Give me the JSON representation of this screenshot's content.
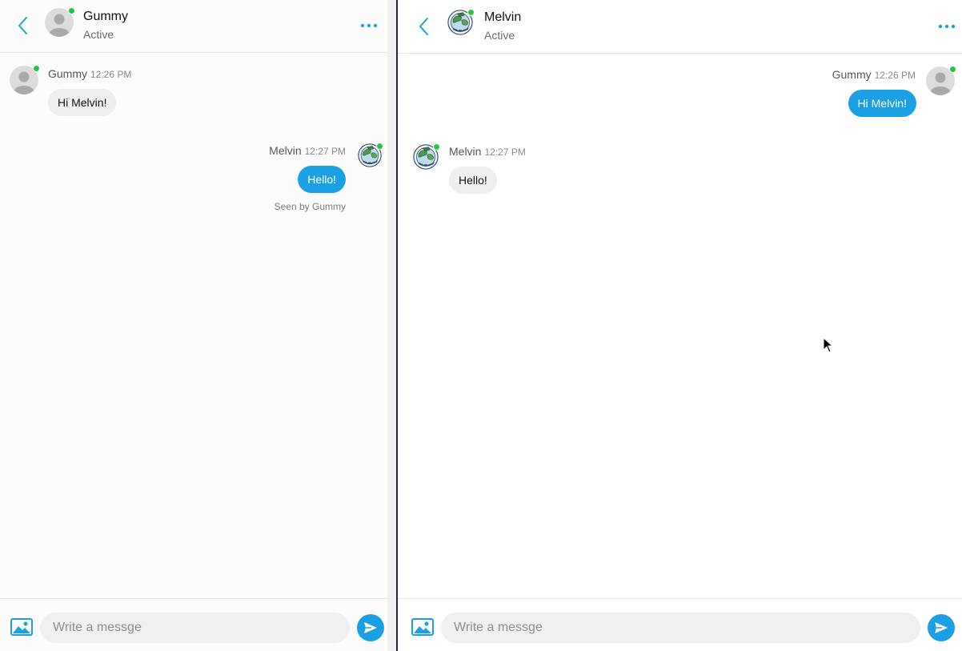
{
  "colors": {
    "accent": "#1ba1e3",
    "online": "#2bc24b",
    "incoming_bubble": "#efefef"
  },
  "left": {
    "header": {
      "name": "Gummy",
      "status": "Active",
      "back_icon": "chevron-left-icon",
      "more_icon": "ellipsis-icon"
    },
    "messages": [
      {
        "sender": "Gummy",
        "time": "12:26 PM",
        "text": "Hi Melvin!",
        "direction": "incoming"
      },
      {
        "sender": "Melvin",
        "time": "12:27 PM",
        "text": "Hello!",
        "direction": "outgoing",
        "seen": "Seen by Gummy"
      }
    ],
    "composer": {
      "placeholder": "Write a messge",
      "image_icon": "image-icon",
      "send_icon": "send-icon"
    }
  },
  "right": {
    "header": {
      "name": "Melvin",
      "status": "Active",
      "back_icon": "chevron-left-icon",
      "more_icon": "ellipsis-icon"
    },
    "messages": [
      {
        "sender": "Gummy",
        "time": "12:26 PM",
        "text": "Hi Melvin!",
        "direction": "outgoing"
      },
      {
        "sender": "Melvin",
        "time": "12:27 PM",
        "text": "Hello!",
        "direction": "incoming"
      }
    ],
    "composer": {
      "placeholder": "Write a messge",
      "image_icon": "image-icon",
      "send_icon": "send-icon"
    }
  }
}
